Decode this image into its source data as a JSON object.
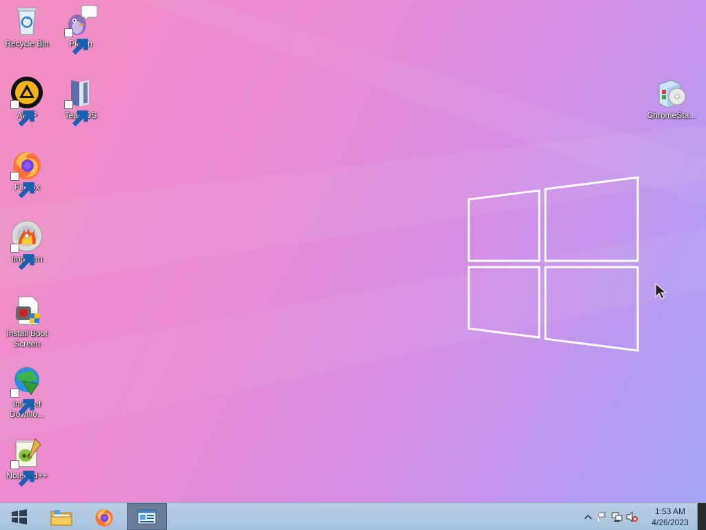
{
  "desktop": {
    "icons": [
      {
        "label": "Recycle Bin",
        "icon": "recycle-bin-icon"
      },
      {
        "label": "Pidgin",
        "icon": "pidgin-icon"
      },
      {
        "label": "AIMP",
        "icon": "aimp-icon"
      },
      {
        "label": "TeamOS",
        "icon": "teamos-icon"
      },
      {
        "label": "Firefox",
        "icon": "firefox-icon"
      },
      {
        "label": "ImgBurn",
        "icon": "imgburn-icon"
      },
      {
        "label": "Install Boot Screen",
        "icon": "install-boot-screen-icon"
      },
      {
        "label": "Internet Downlo...",
        "icon": "internet-download-manager-icon"
      },
      {
        "label": "Notepad++",
        "icon": "notepad-plus-plus-icon"
      },
      {
        "label": "ChromeSta...",
        "icon": "chrome-setup-icon"
      }
    ]
  },
  "taskbar": {
    "start": {
      "icon": "windows-start-icon"
    },
    "pinned": [
      {
        "icon": "file-explorer-icon"
      },
      {
        "icon": "firefox-icon"
      },
      {
        "icon": "control-panel-icon",
        "active": true
      }
    ],
    "tray": {
      "icons": [
        "show-hidden-icons-chevron-icon",
        "action-center-flag-icon",
        "network-icon",
        "volume-muted-icon"
      ]
    },
    "clock": {
      "time": "1:53 AM",
      "date": "4/26/2023"
    }
  },
  "colors": {
    "taskbar": "#b0c8df",
    "wallpaper_start": "#f28fc0",
    "wallpaper_end": "#a3a6f5"
  }
}
